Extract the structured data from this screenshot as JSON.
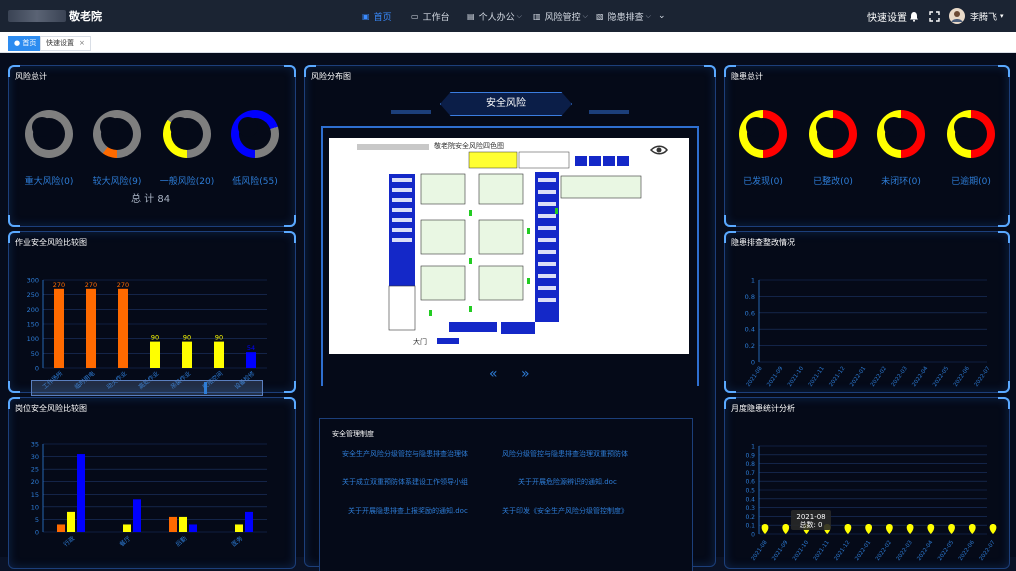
{
  "header": {
    "app_title": "敬老院",
    "nav": [
      {
        "label": "首页",
        "icon": "home-icon",
        "active": true
      },
      {
        "label": "工作台",
        "icon": "desktop-icon"
      },
      {
        "label": "个人办公",
        "icon": "office-icon"
      },
      {
        "label": "风险管控",
        "icon": "shield-icon"
      },
      {
        "label": "隐患排查",
        "icon": "search-doc-icon"
      }
    ],
    "quick_settings": "快速设置",
    "user_name": "李腾飞"
  },
  "tabs": [
    {
      "label": "首页",
      "active": true
    },
    {
      "label": "快速设置",
      "close": "×"
    }
  ],
  "risk_total": {
    "title": "风险总计",
    "items": [
      {
        "label": "重大风险(0)",
        "color": "#7f7f7f",
        "accent": "#7f7f7f",
        "ratio": 0
      },
      {
        "label": "较大风险(9)",
        "color": "#7f7f7f",
        "accent": "#ff6a00",
        "ratio": 0.1
      },
      {
        "label": "一般风险(20)",
        "color": "#7f7f7f",
        "accent": "#ffff00",
        "ratio": 0.35
      },
      {
        "label": "低风险(55)",
        "color": "#7f7f7f",
        "accent": "#0000ff",
        "ratio": 0.7
      }
    ],
    "total": "总 计 84"
  },
  "hazard_total": {
    "title": "隐患总计",
    "items": [
      {
        "label": "已发现(0)"
      },
      {
        "label": "已整改(0)"
      },
      {
        "label": "未闭环(0)"
      },
      {
        "label": "已逾期(0)"
      }
    ],
    "ring_colors": [
      "#ff0000",
      "#ffff00"
    ]
  },
  "risk_map": {
    "title": "风险分布图",
    "banner": "安全风险",
    "map_caption": "敬老院安全风险四色图",
    "entrance": "大门",
    "prev": "«",
    "next": "»"
  },
  "policies": {
    "title": "安全管理制度",
    "items": [
      "安全生产风险分级管控与隐患排查治理体",
      "风险分级管控与隐患排查治理双重预防体",
      "关于成立双重预防体系建设工作领导小组",
      "关于开展危险源辨识的通知.doc",
      "关于开展隐患排查上报奖励的通知.doc",
      "关于印发《安全生产风险分级管控制度》"
    ]
  },
  "job_risk_chart": {
    "title": "作业安全风险比较图",
    "chart_data": {
      "type": "bar",
      "categories": [
        "工作场所",
        "临时用电",
        "动火作业",
        "高处作业",
        "吊装作业",
        "受限空间",
        "设备检修"
      ],
      "values": [
        270,
        270,
        270,
        90,
        90,
        90,
        54
      ],
      "bar_colors": [
        "#ff6a00",
        "#ff6a00",
        "#ff6a00",
        "#ffff00",
        "#ffff00",
        "#ffff00",
        "#0000ff"
      ],
      "ylim": [
        0,
        300
      ],
      "yticks": [
        0,
        50,
        100,
        150,
        200,
        250,
        300
      ]
    }
  },
  "post_risk_chart": {
    "title": "岗位安全风险比较图",
    "chart_data": {
      "type": "bar",
      "categories": [
        "行政",
        "餐厅",
        "后勤",
        "医务"
      ],
      "series": [
        {
          "color": "#ff6a00",
          "values": [
            3,
            0,
            6,
            0
          ]
        },
        {
          "color": "#ffff00",
          "values": [
            8,
            3,
            6,
            3
          ]
        },
        {
          "color": "#0000ff",
          "values": [
            31,
            13,
            3,
            8
          ]
        }
      ],
      "ylim": [
        0,
        35
      ],
      "yticks": [
        0,
        5,
        10,
        15,
        20,
        25,
        30,
        35
      ]
    }
  },
  "hazard_rectify_chart": {
    "title": "隐患排查整改情况",
    "chart_data": {
      "type": "line",
      "x": [
        "2021-08",
        "2021-09",
        "2021-10",
        "2021-11",
        "2021-12",
        "2022-01",
        "2022-02",
        "2022-03",
        "2022-04",
        "2022-05",
        "2022-06",
        "2022-07"
      ],
      "ylim": [
        0,
        1
      ],
      "yticks": [
        "0",
        "0.2",
        "0.4",
        "0.6",
        "0.8",
        "1"
      ]
    }
  },
  "monthly_hazard_chart": {
    "title": "月度隐患统计分析",
    "chart_data": {
      "type": "scatter",
      "x": [
        "2021-08",
        "2021-09",
        "2021-10",
        "2021-11",
        "2021-12",
        "2022-01",
        "2022-02",
        "2022-03",
        "2022-04",
        "2022-05",
        "2022-06",
        "2022-07"
      ],
      "values": [
        0,
        0,
        0,
        0,
        0,
        0,
        0,
        0,
        0,
        0,
        0,
        0
      ],
      "ylim": [
        0,
        1
      ],
      "yticks": [
        "0",
        "0.1",
        "0.2",
        "0.3",
        "0.4",
        "0.5",
        "0.6",
        "0.7",
        "0.8",
        "0.9",
        "1"
      ],
      "tooltip": {
        "month": "2021-08",
        "text": "总数: 0"
      }
    }
  }
}
